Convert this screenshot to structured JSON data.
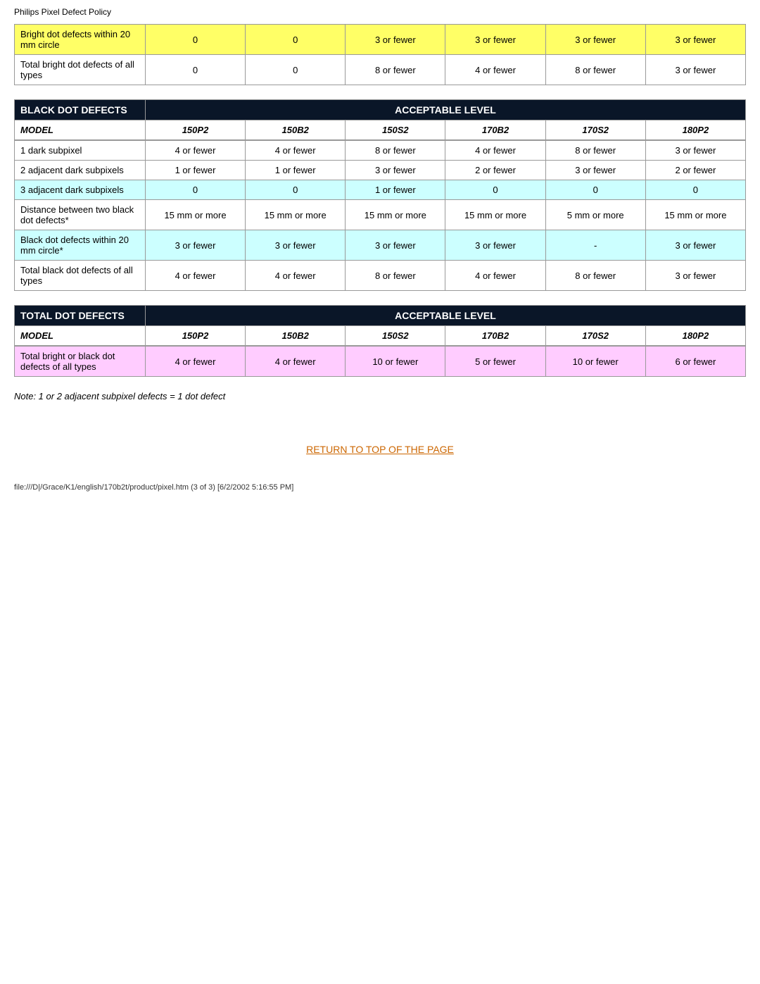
{
  "page": {
    "title": "Philips Pixel Defect Policy"
  },
  "bright_dot_table": {
    "rows": [
      {
        "label": "Bright dot defects within 20 mm circle",
        "highlight": "yellow",
        "values": [
          "0",
          "0",
          "3 or fewer",
          "3 or fewer",
          "3 or fewer",
          "3 or fewer"
        ]
      },
      {
        "label": "Total bright dot defects of all types",
        "highlight": "",
        "values": [
          "0",
          "0",
          "8 or fewer",
          "4 or fewer",
          "8 or fewer",
          "3 or fewer"
        ]
      }
    ]
  },
  "black_dot_section": {
    "header_col": "BLACK DOT DEFECTS",
    "header_level": "ACCEPTABLE LEVEL",
    "model_label": "MODEL",
    "models": [
      "150P2",
      "150B2",
      "150S2",
      "170B2",
      "170S2",
      "180P2"
    ],
    "rows": [
      {
        "label": "1 dark subpixel",
        "highlight": "",
        "values": [
          "4 or fewer",
          "4 or fewer",
          "8 or fewer",
          "4 or fewer",
          "8 or fewer",
          "3 or fewer"
        ]
      },
      {
        "label": "2 adjacent dark subpixels",
        "highlight": "",
        "values": [
          "1 or fewer",
          "1 or fewer",
          "3 or fewer",
          "2 or fewer",
          "3 or fewer",
          "2 or fewer"
        ]
      },
      {
        "label": "3 adjacent dark subpixels",
        "highlight": "cyan",
        "values": [
          "0",
          "0",
          "1 or fewer",
          "0",
          "0",
          "0"
        ]
      },
      {
        "label": "Distance between two black dot defects*",
        "highlight": "",
        "values": [
          "15 mm or more",
          "15 mm or more",
          "15 mm or more",
          "15 mm or more",
          "5 mm or more",
          "15 mm or more"
        ]
      },
      {
        "label": "Black dot defects within 20 mm circle*",
        "highlight": "cyan",
        "values": [
          "3 or fewer",
          "3 or fewer",
          "3 or fewer",
          "3 or fewer",
          "-",
          "3 or fewer"
        ]
      },
      {
        "label": "Total black dot defects of all types",
        "highlight": "",
        "values": [
          "4 or fewer",
          "4 or fewer",
          "8 or fewer",
          "4 or fewer",
          "8 or fewer",
          "3 or fewer"
        ]
      }
    ]
  },
  "total_dot_section": {
    "header_col": "TOTAL DOT DEFECTS",
    "header_level": "ACCEPTABLE LEVEL",
    "model_label": "MODEL",
    "models": [
      "150P2",
      "150B2",
      "150S2",
      "170B2",
      "170S2",
      "180P2"
    ],
    "rows": [
      {
        "label": "Total bright or black dot defects of all types",
        "highlight": "pink",
        "values": [
          "4 or fewer",
          "4 or fewer",
          "10 or fewer",
          "5 or fewer",
          "10 or fewer",
          "6 or fewer"
        ]
      }
    ]
  },
  "note": "Note: 1 or 2 adjacent subpixel defects = 1 dot defect",
  "return_link": "RETURN TO TOP OF THE PAGE",
  "footer": "file:///D|/Grace/K1/english/170b2t/product/pixel.htm (3 of 3) [6/2/2002 5:16:55 PM]"
}
